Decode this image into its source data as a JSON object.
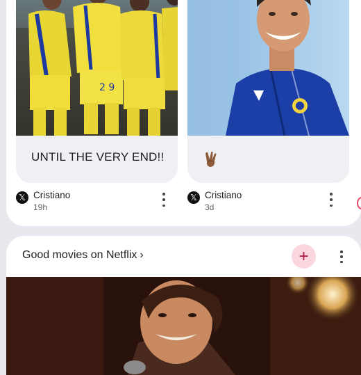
{
  "posts": [
    {
      "caption": "UNTIL THE VERY END!!",
      "author": "Cristiano",
      "time": "19h",
      "source_icon": "x-logo-icon",
      "image": "al-nassr-players-celebrating"
    },
    {
      "caption": "",
      "caption_emoji": "victory-hand-emoji",
      "author": "Cristiano",
      "time": "3d",
      "source_icon": "x-logo-icon",
      "image": "cristiano-smiling-al-nassr-jacket"
    }
  ],
  "feed": {
    "title": "Good movies on Netflix",
    "chevron": "›",
    "follow_icon": "plus-icon",
    "more_icon": "more-vert-icon",
    "image": "man-smiling-on-stage"
  },
  "colors": {
    "background": "#e8e9ee",
    "card": "#ffffff",
    "post_bg": "#eef0f4",
    "follow_btn_bg": "#fbd6df",
    "follow_btn_fg": "#b3173f"
  }
}
